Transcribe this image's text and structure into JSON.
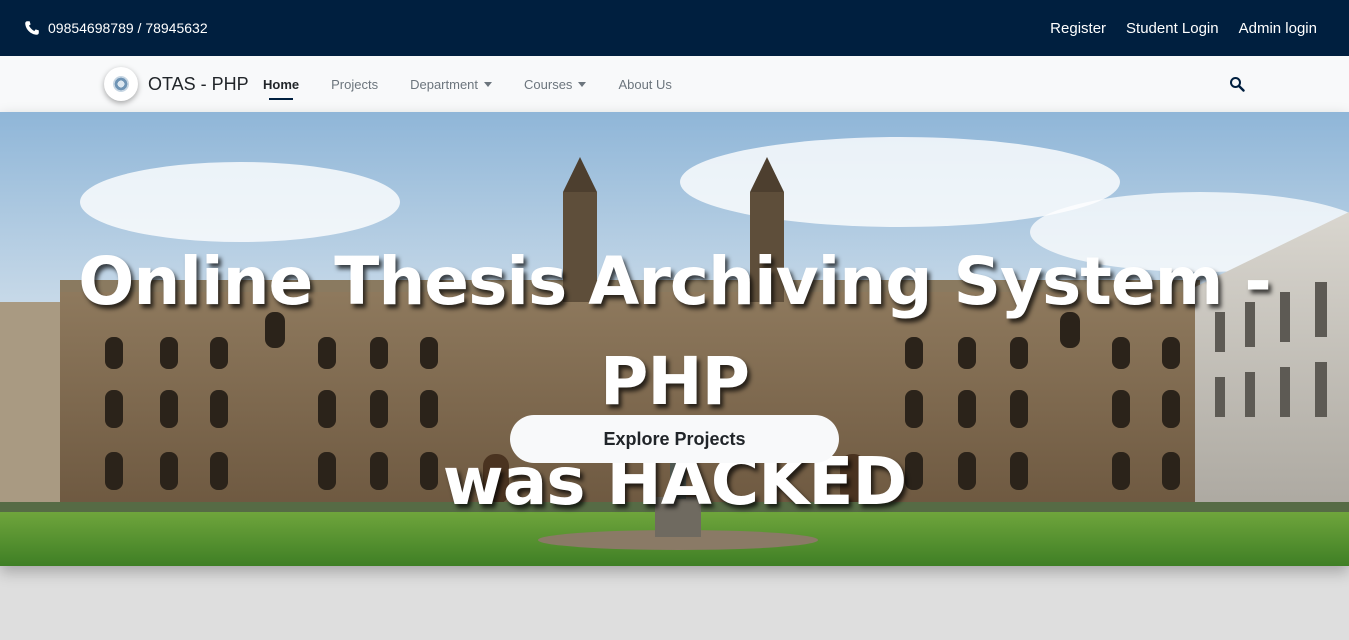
{
  "topbar": {
    "phone": "09854698789 / 78945632",
    "links": [
      "Register",
      "Student Login",
      "Admin login"
    ]
  },
  "navbar": {
    "brand": "OTAS - PHP",
    "items": [
      "Home",
      "Projects",
      "Department",
      "Courses",
      "About Us"
    ],
    "active": "Home"
  },
  "hero": {
    "title_line1": "Online Thesis Archiving System - PHP",
    "title_line2": "was HACKED",
    "button_label": "Explore Projects"
  },
  "colors": {
    "topbar_bg": "#001f3f",
    "navbar_bg": "#f8f9fa",
    "page_bg": "#dedede"
  },
  "icons": [
    "phone-icon",
    "logo-icon",
    "caret-down-icon",
    "search-icon"
  ]
}
